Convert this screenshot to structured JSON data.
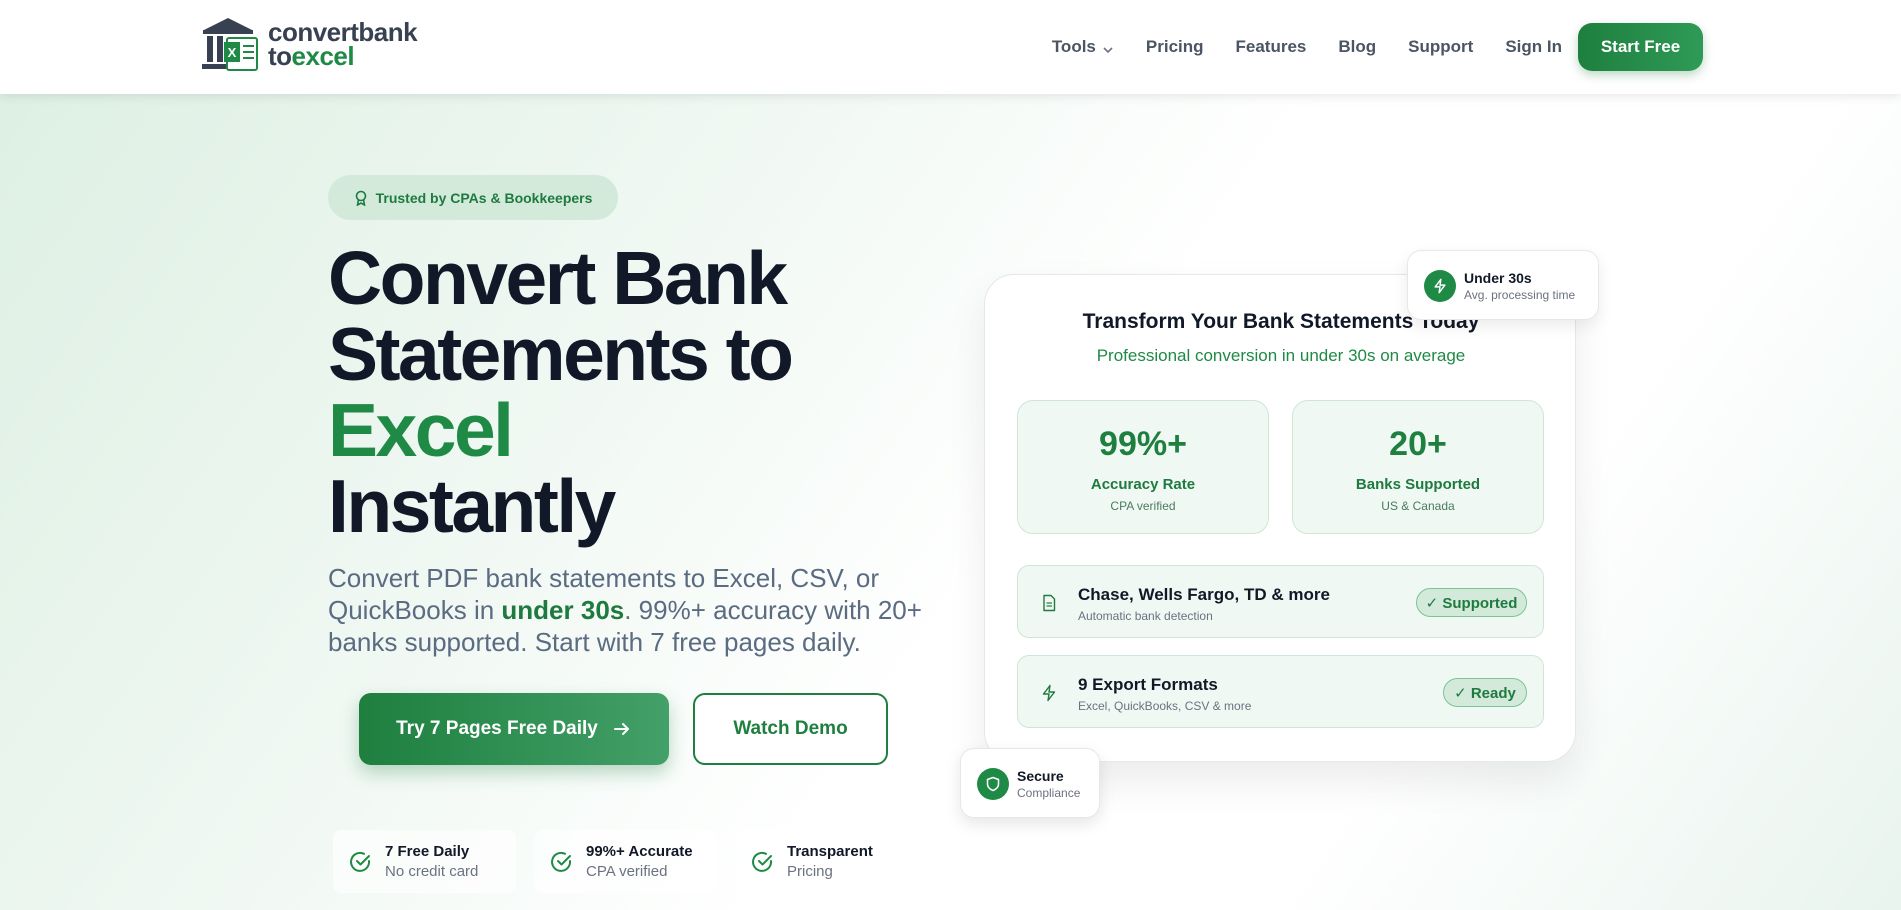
{
  "brand": {
    "line1": "convertbank",
    "line2_to": "to",
    "line2_excel": "excel",
    "colors": {
      "primary": "#1e7f3f",
      "accent": "#1f8a45",
      "text": "#111827",
      "muted": "#5b6b82"
    }
  },
  "nav": {
    "items": [
      {
        "label": "Tools",
        "has_dropdown": true
      },
      {
        "label": "Pricing"
      },
      {
        "label": "Features"
      },
      {
        "label": "Blog"
      },
      {
        "label": "Support"
      },
      {
        "label": "Sign In"
      }
    ],
    "cta": "Start Free"
  },
  "hero": {
    "badge": "Trusted by CPAs & Bookkeepers",
    "title_line1": "Convert Bank",
    "title_line2": "Statements to",
    "title_highlight": "Excel",
    "title_line4": "Instantly",
    "subtitle_part1": "Convert PDF bank statements to Excel, CSV, or QuickBooks in ",
    "subtitle_highlight": "under 30s",
    "subtitle_part2": ". 99%+ accuracy with 20+ banks supported. Start with 7 free pages daily.",
    "primary_cta": "Try 7 Pages Free Daily",
    "secondary_cta": "Watch Demo",
    "chips": [
      {
        "title": "7 Free Daily",
        "sub": "No credit card",
        "icon": "check-circle-icon"
      },
      {
        "title": "99%+ Accurate",
        "sub": "CPA verified",
        "icon": "check-circle-icon"
      },
      {
        "title": "Transparent",
        "sub": "Pricing",
        "icon": "check-circle-icon"
      }
    ]
  },
  "card": {
    "title": "Transform Your Bank Statements Today",
    "subtitle": "Professional conversion in under 30s on average",
    "stats": [
      {
        "value": "99%+",
        "label": "Accuracy Rate",
        "sub": "CPA verified"
      },
      {
        "value": "20+",
        "label": "Banks Supported",
        "sub": "US & Canada"
      }
    ],
    "rows": [
      {
        "title": "Chase, Wells Fargo, TD & more",
        "sub": "Automatic bank detection",
        "pill": "✓ Supported",
        "icon": "document-icon"
      },
      {
        "title": "9 Export Formats",
        "sub": "Excel, QuickBooks, CSV & more",
        "pill": "✓ Ready",
        "icon": "lightning-icon"
      }
    ]
  },
  "floating": {
    "time": {
      "title": "Under 30s",
      "sub": "Avg. processing time",
      "icon": "lightning-icon"
    },
    "secure": {
      "title": "Secure",
      "sub": "Compliance",
      "icon": "shield-icon"
    }
  }
}
